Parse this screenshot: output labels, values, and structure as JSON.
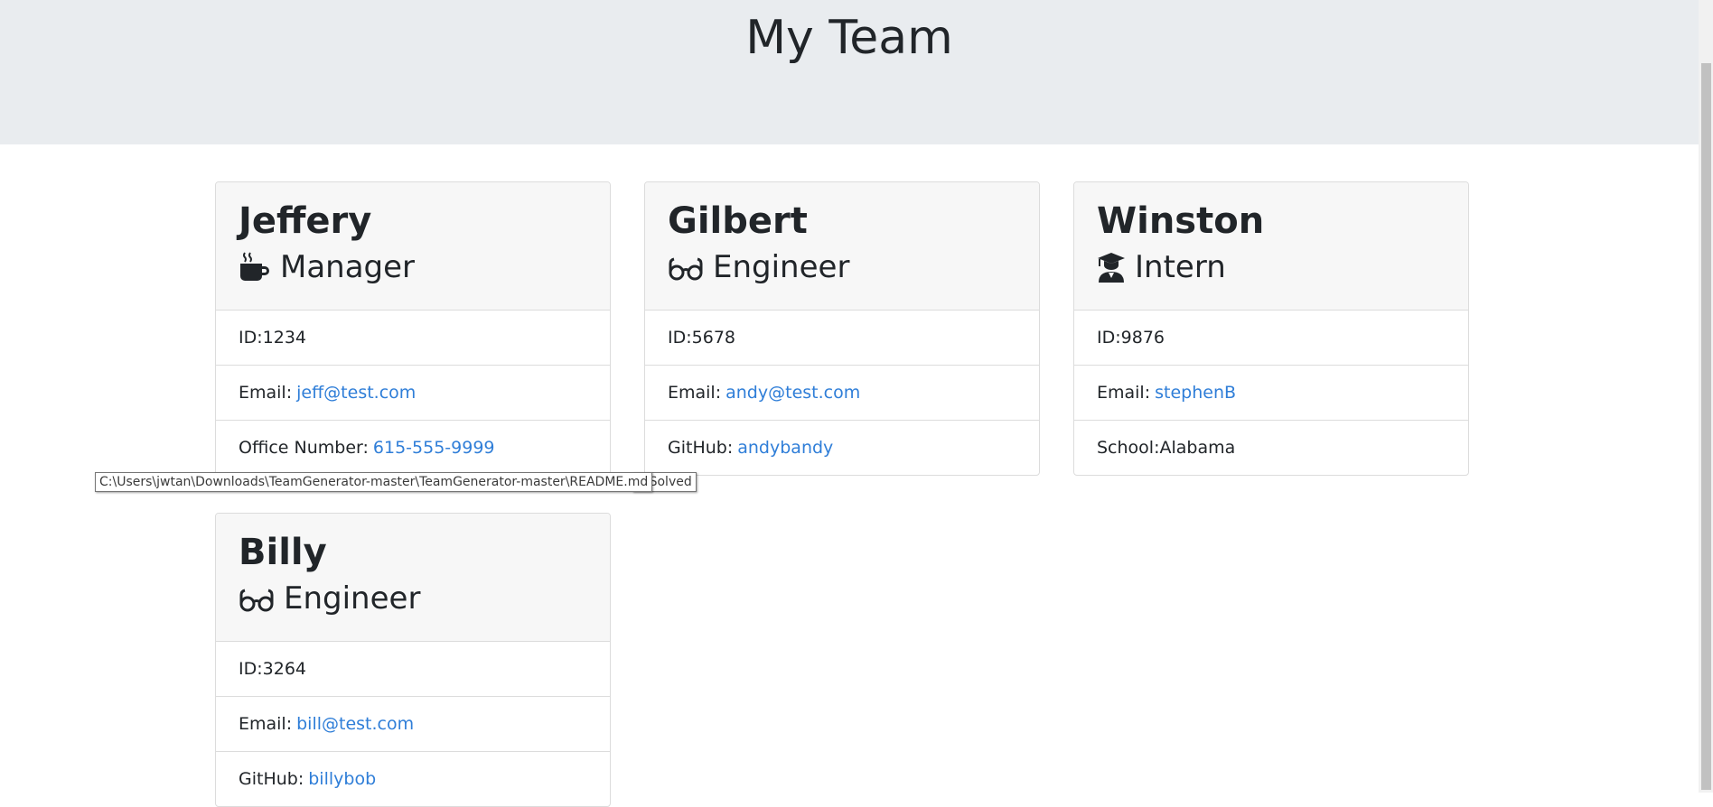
{
  "page_title": "My Team",
  "team": [
    {
      "name": "Jeffery",
      "role": "Manager",
      "role_icon": "coffee-icon",
      "rows": [
        {
          "label": "ID: ",
          "value": "1234",
          "link": false
        },
        {
          "label": "Email: ",
          "value": "jeff@test.com",
          "link": true
        },
        {
          "label": "Office Number: ",
          "value": "615-555-9999",
          "link": true
        }
      ]
    },
    {
      "name": "Gilbert",
      "role": "Engineer",
      "role_icon": "glasses-icon",
      "rows": [
        {
          "label": "ID: ",
          "value": "5678",
          "link": false
        },
        {
          "label": "Email: ",
          "value": "andy@test.com",
          "link": true
        },
        {
          "label": "GitHub: ",
          "value": "andybandy",
          "link": true
        }
      ]
    },
    {
      "name": "Winston",
      "role": "Intern",
      "role_icon": "graduate-icon",
      "rows": [
        {
          "label": "ID: ",
          "value": "9876",
          "link": false
        },
        {
          "label": "Email: ",
          "value": "stephenB",
          "link": true
        },
        {
          "label": "School: ",
          "value": "Alabama",
          "link": false
        }
      ]
    },
    {
      "name": "Billy",
      "role": "Engineer",
      "role_icon": "glasses-icon",
      "rows": [
        {
          "label": "ID: ",
          "value": "3264",
          "link": false
        },
        {
          "label": "Email: ",
          "value": "bill@test.com",
          "link": true
        },
        {
          "label": "GitHub: ",
          "value": "billybob",
          "link": true
        }
      ]
    }
  ],
  "tooltips": {
    "back": "p\\Solved",
    "front": "C:\\Users\\jwtan\\Downloads\\TeamGenerator-master\\TeamGenerator-master\\README.md"
  },
  "colors": {
    "link": "#2f7ed8",
    "header_bg": "#e9ecef",
    "card_header_bg": "#f7f7f7"
  }
}
